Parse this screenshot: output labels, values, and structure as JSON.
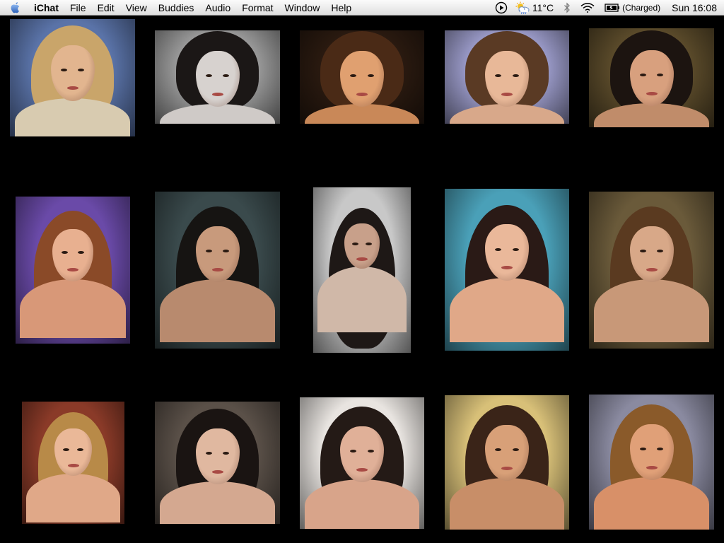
{
  "menubar": {
    "apple_icon": "apple-icon",
    "app_name": "iChat",
    "menus": [
      "File",
      "Edit",
      "View",
      "Buddies",
      "Audio",
      "Format",
      "Window",
      "Help"
    ],
    "status": {
      "play_icon": "play-icon",
      "weather_icon": "weather-partly-cloudy-icon",
      "temperature": "11°C",
      "bluetooth_icon": "bluetooth-icon",
      "wifi_icon": "wifi-icon",
      "battery_icon": "battery-icon",
      "battery_status": "(Charged)",
      "clock": "Sun 16:08"
    }
  },
  "photos": [
    {
      "name": "photo-1",
      "colors": {
        "bg": "#5a73a8",
        "hair": "#c9a56a",
        "skin": "#e2b58f",
        "top": "#d8cbb0"
      }
    },
    {
      "name": "photo-2",
      "colors": {
        "bg": "#9a9a9a",
        "hair": "#1b1716",
        "skin": "#d7d2cf",
        "top": "#cfcac7"
      }
    },
    {
      "name": "photo-3",
      "colors": {
        "bg": "#2a1a10",
        "hair": "#4a2a16",
        "skin": "#e0a070",
        "top": "#c98858"
      }
    },
    {
      "name": "photo-4",
      "colors": {
        "bg": "#9a9ac8",
        "hair": "#5a3a24",
        "skin": "#e8b898",
        "top": "#d8a88a"
      }
    },
    {
      "name": "photo-5",
      "colors": {
        "bg": "#5a4a2a",
        "hair": "#1c1410",
        "skin": "#d8a07e",
        "top": "#c08c6a"
      }
    },
    {
      "name": "photo-6",
      "colors": {
        "bg": "#6a4aa8",
        "hair": "#8a4a28",
        "skin": "#e8b090",
        "top": "#d89878"
      }
    },
    {
      "name": "photo-7",
      "colors": {
        "bg": "#3a4a4c",
        "hair": "#161412",
        "skin": "#c89a7c",
        "top": "#b88a6e"
      }
    },
    {
      "name": "photo-8",
      "colors": {
        "bg": "#c8c8c8",
        "hair": "#1e1816",
        "skin": "#c8a08a",
        "top": "#d0b8a8"
      }
    },
    {
      "name": "photo-9",
      "colors": {
        "bg": "#4aa0b8",
        "hair": "#2a1a16",
        "skin": "#eab89a",
        "top": "#e0a888"
      }
    },
    {
      "name": "photo-10",
      "colors": {
        "bg": "#6a5a3a",
        "hair": "#5a3a20",
        "skin": "#d8a888",
        "top": "#c89878"
      }
    },
    {
      "name": "photo-11",
      "colors": {
        "bg": "#8a3a28",
        "hair": "#b88a48",
        "skin": "#eab898",
        "top": "#e0a888"
      }
    },
    {
      "name": "photo-12",
      "colors": {
        "bg": "#5a5048",
        "hair": "#1a1412",
        "skin": "#e0b8a0",
        "top": "#d4a890"
      }
    },
    {
      "name": "photo-13",
      "colors": {
        "bg": "#e8e4e0",
        "hair": "#241a16",
        "skin": "#e0b098",
        "top": "#d8a48a"
      }
    },
    {
      "name": "photo-14",
      "colors": {
        "bg": "#d8c078",
        "hair": "#3a2418",
        "skin": "#d8a078",
        "top": "#c88e68"
      }
    },
    {
      "name": "photo-15",
      "colors": {
        "bg": "#8a8aa0",
        "hair": "#8a5a2a",
        "skin": "#e0a078",
        "top": "#d89068"
      }
    }
  ]
}
